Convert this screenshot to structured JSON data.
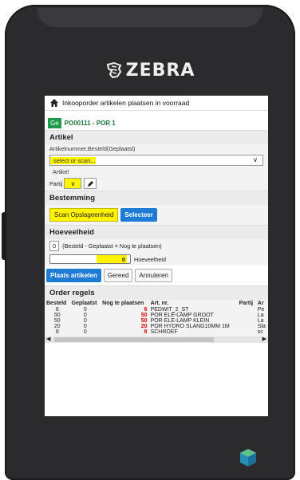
{
  "device": {
    "brand": "ZEBRA"
  },
  "header": {
    "title": "Inkooporder artikelen plaatsen in voorraad"
  },
  "order": {
    "badge": "Ge",
    "code": "PO00111 - POR 1"
  },
  "artikel": {
    "title": "Artikel",
    "input_label": "Artikelnummer,Besteld(Geplaatst)",
    "select_value": "select or scan...",
    "sub_label": "Artikel",
    "partij_label": "Partij"
  },
  "bestemming": {
    "title": "Bestemming",
    "scan_label": "Scan Opslageenheid",
    "select_btn": "Selecteer"
  },
  "hoeveelheid": {
    "title": "Hoeveelheid",
    "value": "0",
    "hint": "(Besteld - Geplaatst = Nog te plaatsen)",
    "input_value": "0",
    "input_label": "Hoeveelheid"
  },
  "actions": {
    "place": "Plaats artikelen",
    "done": "Gereed",
    "cancel": "Annuleren"
  },
  "order_lines": {
    "title": "Order regels",
    "headers": [
      "Besteld",
      "Geplaatst",
      "Nog te plaatsen",
      "Art. nr.",
      "Partij",
      "Ar"
    ],
    "rows": [
      [
        "6",
        "0",
        "6",
        "PEDWIT_2_ST",
        "",
        "Pe"
      ],
      [
        "50",
        "0",
        "50",
        "POR ELE-LAMP GROOT",
        "",
        "La"
      ],
      [
        "50",
        "0",
        "50",
        "POR ELE-LAMP KLEIN",
        "",
        "La"
      ],
      [
        "20",
        "0",
        "20",
        "POR HYDRO SLANG10MM 1M",
        "",
        "Sla"
      ],
      [
        "8",
        "0",
        "8",
        "SCHROEF",
        "",
        "sc"
      ]
    ]
  },
  "colors": {
    "accent": "#1e7bd6",
    "highlight": "#fff300",
    "badge": "#1e9b48",
    "alert": "#dd0000"
  }
}
